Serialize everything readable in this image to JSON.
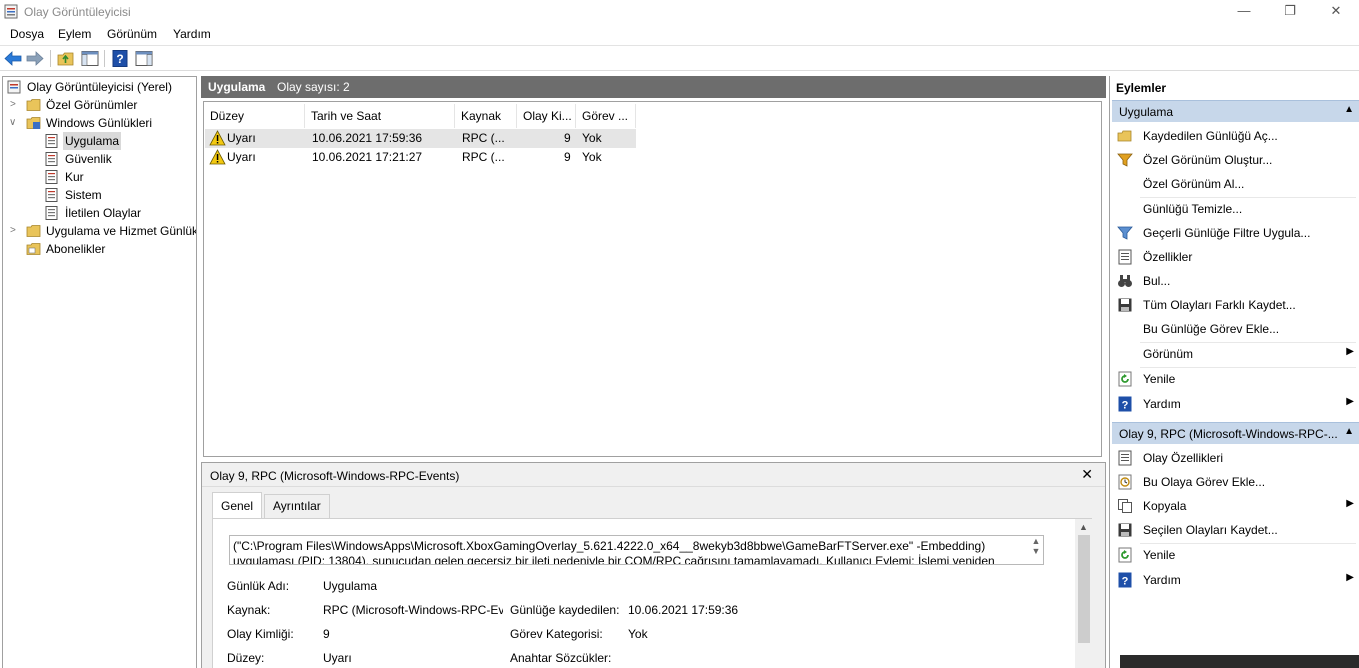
{
  "window": {
    "title": "Olay Görüntüleyicisi",
    "controls": {
      "minimize": "—",
      "maximize": "❐",
      "close": "✕"
    }
  },
  "menu": [
    "Dosya",
    "Eylem",
    "Görünüm",
    "Yardım"
  ],
  "toolbar": {
    "icons": [
      "back-arrow-icon",
      "forward-arrow-icon",
      "folder-up-icon",
      "show-hide-tree-icon",
      "help-icon",
      "show-hide-action-pane-icon"
    ],
    "colors": {
      "arrow": "#2a7ad8",
      "help": "#1e4fa8"
    }
  },
  "tree": {
    "root": "Olay Görüntüleyicisi (Yerel)",
    "custom_views": "Özel Görünümler",
    "windows_logs": "Windows Günlükleri",
    "logs": [
      "Uygulama",
      "Güvenlik",
      "Kur",
      "Sistem",
      "İletilen Olaylar"
    ],
    "app_service_logs": "Uygulama ve Hizmet Günlükleri",
    "subscriptions": "Abonelikler",
    "selected": "Uygulama"
  },
  "list": {
    "band_title": "Uygulama",
    "band_count": "Olay sayısı: 2",
    "columns": [
      "Düzey",
      "Tarih ve Saat",
      "Kaynak",
      "Olay Ki...",
      "Görev ..."
    ],
    "rows": [
      {
        "level": "Uyarı",
        "datetime": "10.06.2021 17:59:36",
        "source": "RPC (...",
        "event_id": "9",
        "task": "Yok"
      },
      {
        "level": "Uyarı",
        "datetime": "10.06.2021 17:21:27",
        "source": "RPC (...",
        "event_id": "9",
        "task": "Yok"
      }
    ]
  },
  "detail": {
    "title": "Olay 9, RPC (Microsoft-Windows-RPC-Events)",
    "close": "✕",
    "tabs": [
      "Genel",
      "Ayrıntılar"
    ],
    "message": "(\"C:\\Program Files\\WindowsApps\\Microsoft.XboxGamingOverlay_5.621.4222.0_x64__8wekyb3d8bbwe\\GameBarFTServer.exe\" -Embedding) uygulaması (PID: 13804), sunucudan gelen geçersiz bir ileti nedeniyle bir COM/RPC çağrısını tamamlayamadı. Kullanıcı Eylemi: İşlemi yeniden deneyin.",
    "fields": {
      "log_name_label": "Günlük Adı:",
      "log_name": "Uygulama",
      "source_label": "Kaynak:",
      "source": "RPC (Microsoft-Windows-RPC-Events)",
      "logged_label": "Günlüğe kaydedilen:",
      "logged": "10.06.2021 17:59:36",
      "event_id_label": "Olay Kimliği:",
      "event_id": "9",
      "task_label": "Görev Kategorisi:",
      "task": "Yok",
      "level_label": "Düzey:",
      "level": "Uyarı",
      "keywords_label": "Anahtar Sözcükler:"
    }
  },
  "actions": {
    "title": "Eylemler",
    "section1": "Uygulama",
    "items1": [
      "Kaydedilen Günlüğü Aç...",
      "Özel Görünüm Oluştur...",
      "Özel Görünüm Al...",
      "Günlüğü Temizle...",
      "Geçerli Günlüğe Filtre Uygula...",
      "Özellikler",
      "Bul...",
      "Tüm Olayları Farklı Kaydet...",
      "Bu Günlüğe Görev Ekle...",
      "Görünüm",
      "Yenile",
      "Yardım"
    ],
    "section2": "Olay 9, RPC (Microsoft-Windows-RPC-...",
    "items2": [
      "Olay Özellikleri",
      "Bu Olaya Görev Ekle...",
      "Kopyala",
      "Seçilen Olayları Kaydet...",
      "Yenile",
      "Yardım"
    ],
    "submenu_arrow": "▶",
    "collapse": "▲"
  }
}
